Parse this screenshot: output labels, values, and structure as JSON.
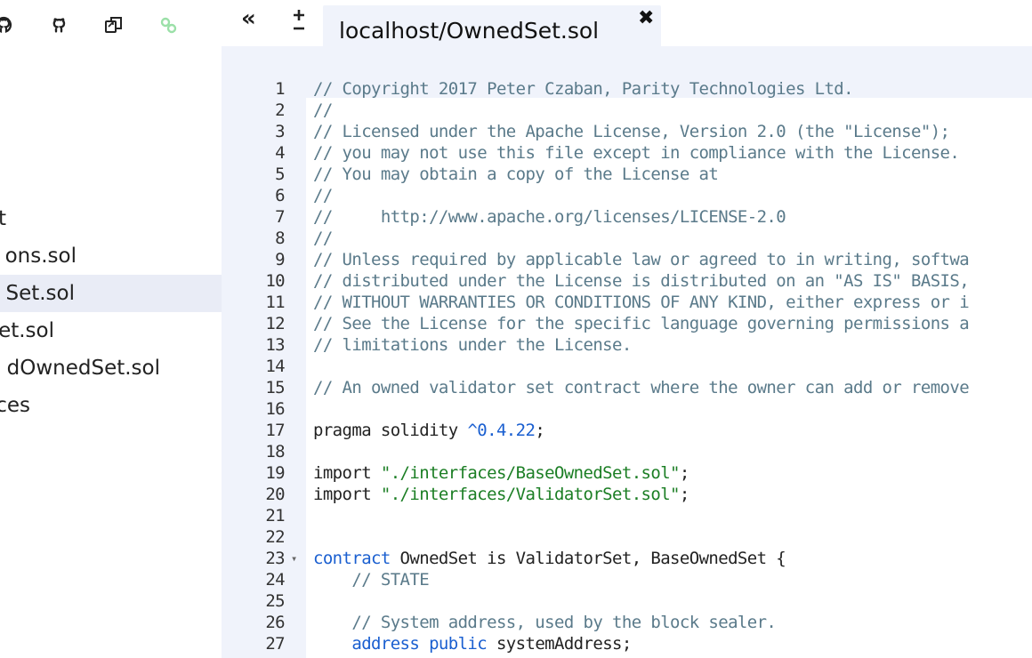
{
  "sidebar": {
    "icons": [
      {
        "name": "github-icon-1"
      },
      {
        "name": "github-icon-2"
      },
      {
        "name": "copy-icon"
      },
      {
        "name": "link-icon"
      }
    ],
    "files": [
      {
        "label": "t",
        "selected": false
      },
      {
        "label": "ons.sol",
        "selected": false
      },
      {
        "label": "Set.sol",
        "selected": true
      },
      {
        "label": "et.sol",
        "selected": false
      },
      {
        "label": "dOwnedSet.sol",
        "selected": false
      },
      {
        "label": "ces",
        "selected": false
      }
    ]
  },
  "tabbar": {
    "collapse_label": "«",
    "zoom_label": "±",
    "tab_label": "localhost/OwnedSet.sol",
    "close_label": "✖"
  },
  "editor": {
    "lines": [
      {
        "n": "1",
        "tokens": [
          [
            "c",
            "// Copyright 2017 Peter Czaban, Parity Technologies Ltd."
          ]
        ]
      },
      {
        "n": "2",
        "tokens": [
          [
            "c",
            "//"
          ]
        ]
      },
      {
        "n": "3",
        "tokens": [
          [
            "c",
            "// Licensed under the Apache License, Version 2.0 (the \"License\");"
          ]
        ]
      },
      {
        "n": "4",
        "tokens": [
          [
            "c",
            "// you may not use this file except in compliance with the License."
          ]
        ]
      },
      {
        "n": "5",
        "tokens": [
          [
            "c",
            "// You may obtain a copy of the License at"
          ]
        ]
      },
      {
        "n": "6",
        "tokens": [
          [
            "c",
            "//"
          ]
        ]
      },
      {
        "n": "7",
        "tokens": [
          [
            "c",
            "//     http://www.apache.org/licenses/LICENSE-2.0"
          ]
        ]
      },
      {
        "n": "8",
        "tokens": [
          [
            "c",
            "//"
          ]
        ]
      },
      {
        "n": "9",
        "tokens": [
          [
            "c",
            "// Unless required by applicable law or agreed to in writing, softwa"
          ]
        ]
      },
      {
        "n": "10",
        "tokens": [
          [
            "c",
            "// distributed under the License is distributed on an \"AS IS\" BASIS,"
          ]
        ]
      },
      {
        "n": "11",
        "tokens": [
          [
            "c",
            "// WITHOUT WARRANTIES OR CONDITIONS OF ANY KIND, either express or i"
          ]
        ]
      },
      {
        "n": "12",
        "tokens": [
          [
            "c",
            "// See the License for the specific language governing permissions a"
          ]
        ]
      },
      {
        "n": "13",
        "tokens": [
          [
            "c",
            "// limitations under the License."
          ]
        ]
      },
      {
        "n": "14",
        "tokens": []
      },
      {
        "n": "15",
        "tokens": [
          [
            "c",
            "// An owned validator set contract where the owner can add or remove"
          ]
        ]
      },
      {
        "n": "16",
        "tokens": []
      },
      {
        "n": "17",
        "tokens": [
          [
            "p",
            "pragma solidity "
          ],
          [
            "n",
            "^0.4.22"
          ],
          [
            "p",
            ";"
          ]
        ]
      },
      {
        "n": "18",
        "tokens": []
      },
      {
        "n": "19",
        "tokens": [
          [
            "p",
            "import "
          ],
          [
            "s",
            "\"./interfaces/BaseOwnedSet.sol\""
          ],
          [
            "p",
            ";"
          ]
        ]
      },
      {
        "n": "20",
        "tokens": [
          [
            "p",
            "import "
          ],
          [
            "s",
            "\"./interfaces/ValidatorSet.sol\""
          ],
          [
            "p",
            ";"
          ]
        ]
      },
      {
        "n": "21",
        "tokens": []
      },
      {
        "n": "22",
        "tokens": []
      },
      {
        "n": "23",
        "fold": true,
        "tokens": [
          [
            "k",
            "contract"
          ],
          [
            "p",
            " OwnedSet is ValidatorSet, BaseOwnedSet {"
          ]
        ]
      },
      {
        "n": "24",
        "tokens": [
          [
            "p",
            "    "
          ],
          [
            "c",
            "// STATE"
          ]
        ]
      },
      {
        "n": "25",
        "tokens": []
      },
      {
        "n": "26",
        "tokens": [
          [
            "p",
            "    "
          ],
          [
            "c",
            "// System address, used by the block sealer."
          ]
        ]
      },
      {
        "n": "27",
        "tokens": [
          [
            "p",
            "    "
          ],
          [
            "k",
            "address"
          ],
          [
            "p",
            " "
          ],
          [
            "k",
            "public"
          ],
          [
            "p",
            " systemAddress;"
          ]
        ]
      }
    ]
  }
}
